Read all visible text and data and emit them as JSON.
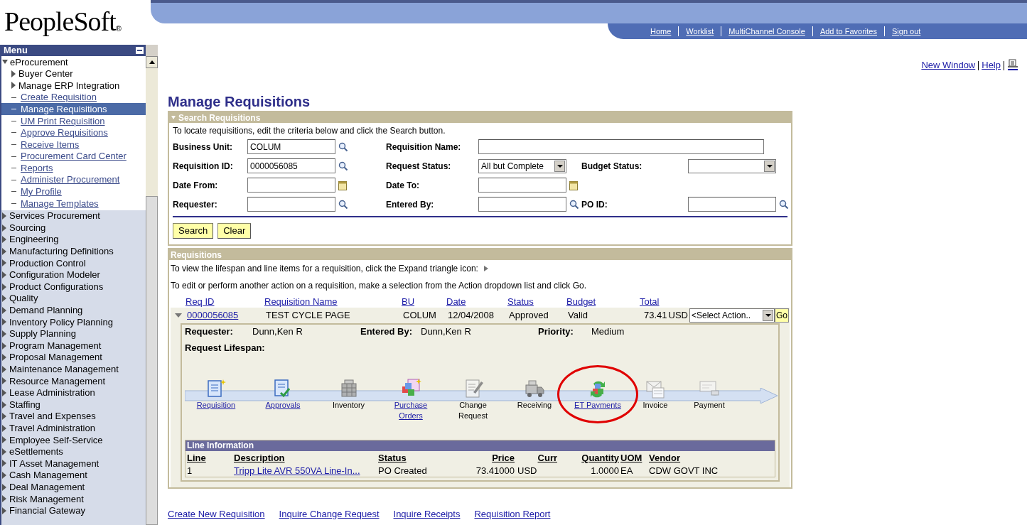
{
  "header": {
    "logo": "PeopleSoft",
    "logo_mark": "®",
    "nav": [
      "Home",
      "Worklist",
      "MultiChannel Console",
      "Add to Favorites",
      "Sign out"
    ]
  },
  "utility_links": [
    "New Window",
    "Help"
  ],
  "menu": {
    "title": "Menu",
    "items": [
      {
        "label": "eProcurement",
        "kind": "folder",
        "expanded": true,
        "selected": false,
        "children": [
          {
            "label": "Buyer Center",
            "kind": "folder",
            "expanded": false,
            "selected": false
          },
          {
            "label": "Manage ERP Integration",
            "kind": "folder",
            "expanded": false,
            "selected": false
          },
          {
            "label": "Create Requisition",
            "kind": "link",
            "selected": false
          },
          {
            "label": "Manage Requisitions",
            "kind": "link",
            "selected": true
          },
          {
            "label": "UM Print Requisition",
            "kind": "link",
            "selected": false
          },
          {
            "label": "Approve Requisitions",
            "kind": "link",
            "selected": false
          },
          {
            "label": "Receive Items",
            "kind": "link",
            "selected": false
          },
          {
            "label": "Procurement Card Center",
            "kind": "link",
            "selected": false
          },
          {
            "label": "Reports",
            "kind": "link",
            "selected": false
          },
          {
            "label": "Administer Procurement",
            "kind": "link",
            "selected": false
          },
          {
            "label": "My Profile",
            "kind": "link",
            "selected": false
          },
          {
            "label": "Manage Templates",
            "kind": "link",
            "selected": false
          }
        ]
      },
      {
        "label": "Services Procurement",
        "kind": "folder",
        "expanded": false,
        "selected": false
      },
      {
        "label": "Sourcing",
        "kind": "folder",
        "expanded": false,
        "selected": false
      },
      {
        "label": "Engineering",
        "kind": "folder",
        "expanded": false,
        "selected": false
      },
      {
        "label": "Manufacturing Definitions",
        "kind": "folder",
        "expanded": false,
        "selected": false
      },
      {
        "label": "Production Control",
        "kind": "folder",
        "expanded": false,
        "selected": false
      },
      {
        "label": "Configuration Modeler",
        "kind": "folder",
        "expanded": false,
        "selected": false
      },
      {
        "label": "Product Configurations",
        "kind": "folder",
        "expanded": false,
        "selected": false
      },
      {
        "label": "Quality",
        "kind": "folder",
        "expanded": false,
        "selected": false
      },
      {
        "label": "Demand Planning",
        "kind": "folder",
        "expanded": false,
        "selected": false
      },
      {
        "label": "Inventory Policy Planning",
        "kind": "folder",
        "expanded": false,
        "selected": false
      },
      {
        "label": "Supply Planning",
        "kind": "folder",
        "expanded": false,
        "selected": false
      },
      {
        "label": "Program Management",
        "kind": "folder",
        "expanded": false,
        "selected": false
      },
      {
        "label": "Proposal Management",
        "kind": "folder",
        "expanded": false,
        "selected": false
      },
      {
        "label": "Maintenance Management",
        "kind": "folder",
        "expanded": false,
        "selected": false
      },
      {
        "label": "Resource Management",
        "kind": "folder",
        "expanded": false,
        "selected": false
      },
      {
        "label": "Lease Administration",
        "kind": "folder",
        "expanded": false,
        "selected": false
      },
      {
        "label": "Staffing",
        "kind": "folder",
        "expanded": false,
        "selected": false
      },
      {
        "label": "Travel and Expenses",
        "kind": "folder",
        "expanded": false,
        "selected": false
      },
      {
        "label": "Travel Administration",
        "kind": "folder",
        "expanded": false,
        "selected": false
      },
      {
        "label": "Employee Self-Service",
        "kind": "folder",
        "expanded": false,
        "selected": false
      },
      {
        "label": "eSettlements",
        "kind": "folder",
        "expanded": false,
        "selected": false
      },
      {
        "label": "IT Asset Management",
        "kind": "folder",
        "expanded": false,
        "selected": false
      },
      {
        "label": "Cash Management",
        "kind": "folder",
        "expanded": false,
        "selected": false
      },
      {
        "label": "Deal Management",
        "kind": "folder",
        "expanded": false,
        "selected": false
      },
      {
        "label": "Risk Management",
        "kind": "folder",
        "expanded": false,
        "selected": false
      },
      {
        "label": "Financial Gateway",
        "kind": "folder",
        "expanded": false,
        "selected": false
      }
    ]
  },
  "page_title": "Manage Requisitions",
  "search": {
    "title": "Search Requisitions",
    "instructions": "To locate requisitions, edit the criteria below and click the Search button.",
    "fields": [
      {
        "label": "Business Unit:",
        "kind": "lookup",
        "value": "COLUM"
      },
      {
        "label": "Requisition Name:",
        "kind": "wide"
      },
      {
        "label": "Requisition ID:",
        "kind": "lookup",
        "value": "0000056085"
      },
      {
        "label": "Request Status:",
        "kind": "select",
        "value": "All but Complete"
      },
      {
        "label": "Budget Status:",
        "kind": "select"
      },
      {
        "label": "Date From:",
        "kind": "date"
      },
      {
        "label": "Date To:",
        "kind": "date"
      },
      {
        "label": "Requester:",
        "kind": "lookup"
      },
      {
        "label": "Entered By:",
        "kind": "lookup"
      },
      {
        "label": "PO ID:",
        "kind": "lookup"
      }
    ],
    "buttons": [
      "Search",
      "Clear"
    ]
  },
  "requisitions": {
    "title": "Requisitions",
    "help_expand": "To view the lifespan and line items for a requisition, click the Expand triangle icon:",
    "help_action": "To edit or perform another action on a requisition, make a selection from the Action dropdown list and click Go.",
    "columns": [
      "Req ID",
      "Requisition Name",
      "BU",
      "Date",
      "Status",
      "Budget",
      "Total"
    ],
    "rows": [
      {
        "expanded": true,
        "req_id": "0000056085",
        "name": "TEST CYCLE PAGE",
        "bu": "COLUM",
        "date": "12/04/2008",
        "status": "Approved",
        "budget": "Valid",
        "total": "73.41",
        "currency": "USD",
        "action": "<Select Action..",
        "go": "Go",
        "details": [
          {
            "label": "Requester:",
            "value": "Dunn,Ken R"
          },
          {
            "label": "Entered By:",
            "value": "Dunn,Ken R"
          },
          {
            "label": "Priority:",
            "value": "Medium"
          }
        ],
        "lifespan_title": "Request Lifespan:",
        "stages": [
          {
            "label": "Requisition",
            "linked": true,
            "highlighted": false
          },
          {
            "label": "Approvals",
            "linked": true,
            "highlighted": false
          },
          {
            "label": "Inventory",
            "linked": false,
            "highlighted": false
          },
          {
            "label": "Purchase Orders",
            "linked": true,
            "highlighted": false
          },
          {
            "label": "Change Request",
            "linked": false,
            "highlighted": false
          },
          {
            "label": "Receiving",
            "linked": false,
            "highlighted": false
          },
          {
            "label": "ET Payments",
            "linked": true,
            "highlighted": true
          },
          {
            "label": "Invoice",
            "linked": false,
            "highlighted": false
          },
          {
            "label": "Payment",
            "linked": false,
            "highlighted": false
          }
        ],
        "line_info": {
          "title": "Line Information",
          "columns": [
            "Line",
            "Description",
            "Status",
            "Price",
            "Curr",
            "Quantity",
            "UOM",
            "Vendor"
          ],
          "rows": [
            [
              "1",
              "Tripp Lite AVR 550VA Line-In...",
              "PO Created",
              "73.41000",
              "USD",
              "1.0000",
              "EA",
              "CDW GOVT INC"
            ]
          ]
        }
      }
    ]
  },
  "footer_links": [
    "Create New Requisition",
    "Inquire Change Request",
    "Inquire Receipts",
    "Requisition Report"
  ]
}
